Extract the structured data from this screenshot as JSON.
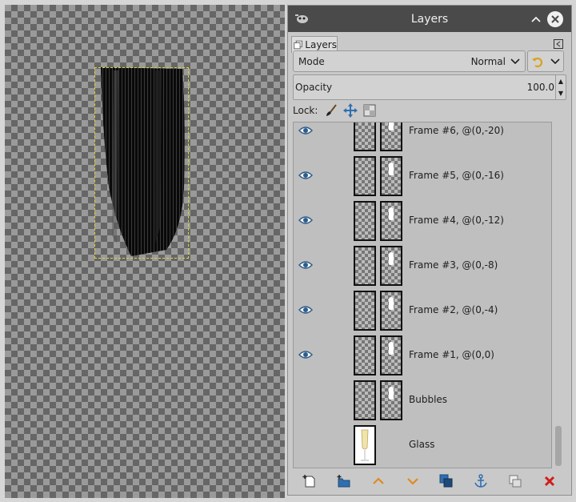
{
  "dialog": {
    "title": "Layers",
    "tab_label": "Layers",
    "mode_label": "Mode",
    "mode_value": "Normal",
    "opacity_label": "Opacity",
    "opacity_value": "100.0",
    "lock_label": "Lock:"
  },
  "layers": [
    {
      "name": "Frame #6, @(0,-20)",
      "visible": true
    },
    {
      "name": "Frame #5, @(0,-16)",
      "visible": true
    },
    {
      "name": "Frame #4, @(0,-12)",
      "visible": true
    },
    {
      "name": "Frame #3, @(0,-8)",
      "visible": true
    },
    {
      "name": "Frame #2, @(0,-4)",
      "visible": true
    },
    {
      "name": "Frame #1, @(0,0)",
      "visible": true
    },
    {
      "name": "Bubbles",
      "visible": false
    },
    {
      "name": "Glass",
      "visible": false
    }
  ],
  "icons": {
    "close": "close-icon",
    "minimize": "chevron-up-icon",
    "eye": "eye-icon",
    "lock_pixels": "paintbrush-icon",
    "lock_position": "move-icon",
    "lock_alpha": "alpha-checker-icon"
  },
  "colors": {
    "titlebar": "#4a4a4a",
    "selection_boundary": "#e0d23a",
    "eye": "#2f5d8a",
    "delete": "#d11d1d",
    "arrow": "#e08a1e"
  }
}
